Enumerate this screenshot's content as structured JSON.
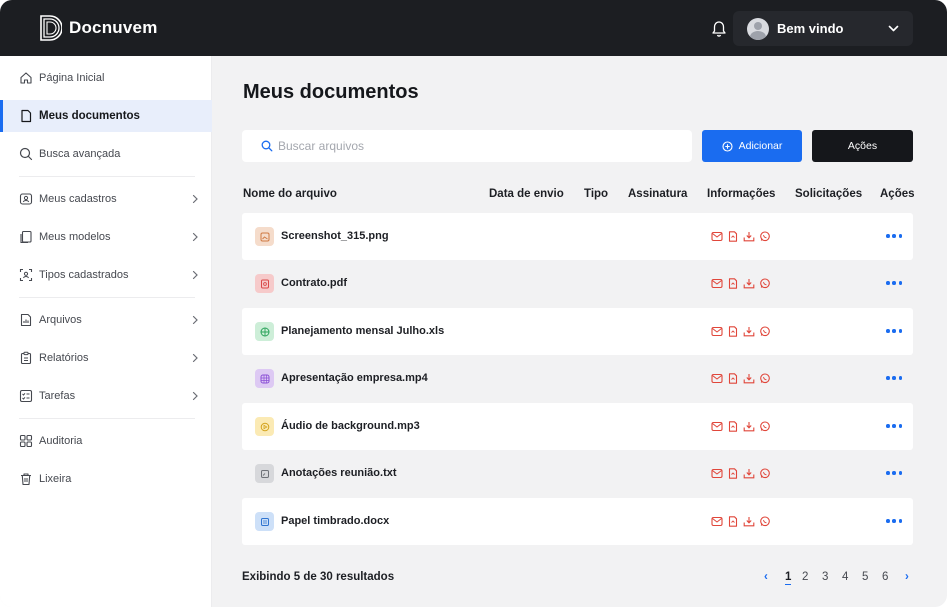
{
  "app": {
    "title": "Docnuvem"
  },
  "header": {
    "user_greeting": "Bem vindo"
  },
  "sidebar": {
    "items": [
      {
        "label": "Página Inicial"
      },
      {
        "label": "Meus documentos"
      },
      {
        "label": "Busca avançada"
      },
      {
        "label": "Meus cadastros"
      },
      {
        "label": "Meus modelos"
      },
      {
        "label": "Tipos cadastrados"
      },
      {
        "label": "Arquivos"
      },
      {
        "label": "Relatórios"
      },
      {
        "label": "Tarefas"
      },
      {
        "label": "Auditoria"
      },
      {
        "label": "Lixeira"
      }
    ],
    "active": "Meus documentos"
  },
  "main": {
    "title": "Meus documentos",
    "search": {
      "placeholder": "Buscar arquivos",
      "value": ""
    },
    "add_button": "Adicionar",
    "actions_button": "Ações",
    "columns": [
      "Nome do arquivo",
      "Data de envio",
      "Tipo",
      "Assinatura",
      "Informações",
      "Solicitações",
      "Ações"
    ],
    "files": [
      {
        "name": "Screenshot_315.png",
        "icon": "image-icon"
      },
      {
        "name": "Contrato.pdf",
        "icon": "pdf-icon"
      },
      {
        "name": "Planejamento mensal Julho.xls",
        "icon": "spreadsheet-icon"
      },
      {
        "name": "Apresentação empresa.mp4",
        "icon": "video-icon"
      },
      {
        "name": "Áudio de background.mp3",
        "icon": "audio-icon"
      },
      {
        "name": "Anotações reunião.txt",
        "icon": "text-icon"
      },
      {
        "name": "Papel timbrado.docx",
        "icon": "document-icon"
      }
    ],
    "info_icons": [
      "email-icon",
      "file-icon",
      "download-icon",
      "whatsapp-icon"
    ],
    "footer": {
      "summary": "Exibindo 5 de 30 resultados"
    },
    "pagination": {
      "prev": "‹",
      "pages": [
        "1",
        "2",
        "3",
        "4",
        "5",
        "6"
      ],
      "current": "1",
      "next": "›"
    }
  },
  "colors": {
    "primary": "#1a6cf0",
    "topbar": "#1c1e22",
    "info_icon": "#e0463a"
  }
}
